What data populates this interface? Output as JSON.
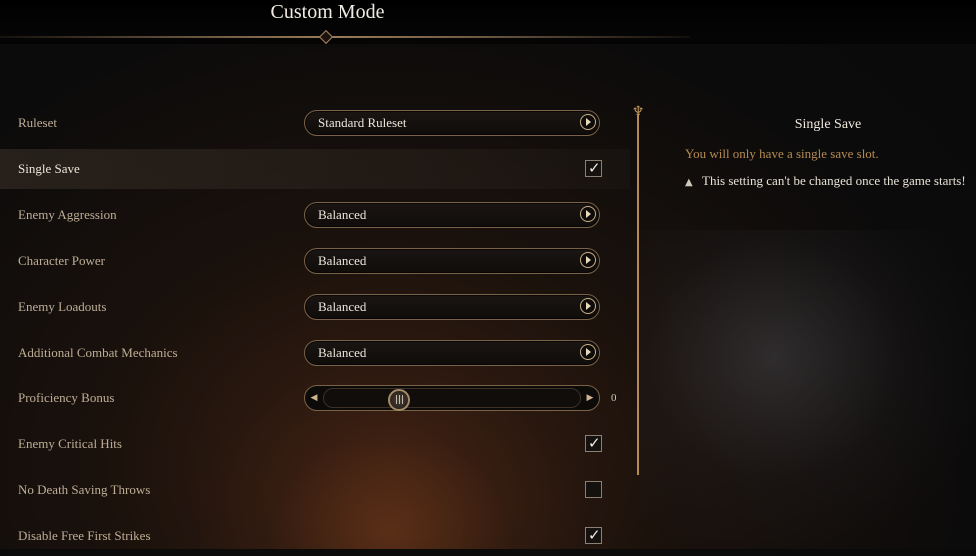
{
  "title": "Custom Mode",
  "settings": [
    {
      "label": "Ruleset",
      "type": "dropdown",
      "value": "Standard Ruleset"
    },
    {
      "label": "Single Save",
      "type": "checkbox",
      "checked": true,
      "selected": true
    },
    {
      "label": "Enemy Aggression",
      "type": "dropdown",
      "value": "Balanced"
    },
    {
      "label": "Character Power",
      "type": "dropdown",
      "value": "Balanced"
    },
    {
      "label": "Enemy Loadouts",
      "type": "dropdown",
      "value": "Balanced"
    },
    {
      "label": "Additional Combat Mechanics",
      "type": "dropdown",
      "value": "Balanced"
    },
    {
      "label": "Proficiency Bonus",
      "type": "slider",
      "value": "0"
    },
    {
      "label": "Enemy Critical Hits",
      "type": "checkbox",
      "checked": true
    },
    {
      "label": "No Death Saving Throws",
      "type": "checkbox",
      "checked": false
    },
    {
      "label": "Disable Free First Strikes",
      "type": "checkbox",
      "checked": true
    }
  ],
  "detail": {
    "title": "Single Save",
    "description": "You will only have a single save slot.",
    "warning": "This setting can't be changed once the game starts!"
  },
  "icons": {
    "check": "✓",
    "warning": "▲",
    "arrow_left": "◀",
    "arrow_right": "▶",
    "thumb": "|||",
    "scroll_top": "♆"
  },
  "colors": {
    "accent_gold": "#b58b52",
    "label": "#bfae96",
    "text_light": "#ece6da"
  }
}
